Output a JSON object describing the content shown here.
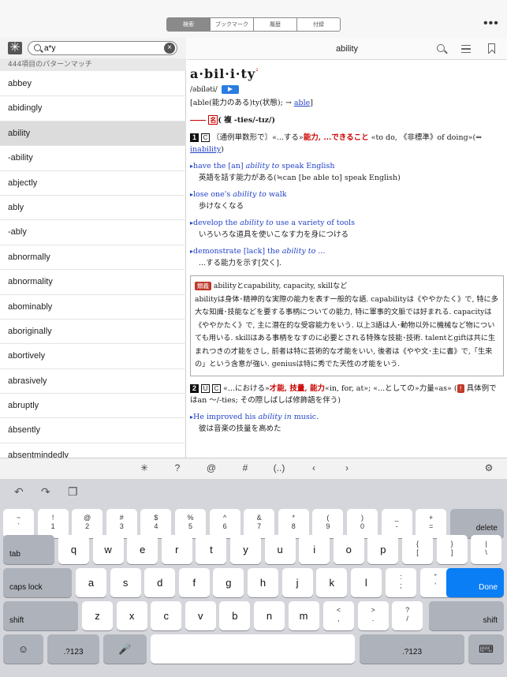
{
  "top_tabs": [
    "検索",
    "ブックマーク",
    "履歴",
    "付録"
  ],
  "active_tab": "検索",
  "more_label": "•••",
  "search": {
    "value": "a*y",
    "clear": "×",
    "wildcard_button": "✳︎"
  },
  "match_count": "444項目のパターンマッチ",
  "results": [
    "abbey",
    "abidingly",
    "ability",
    "-ability",
    "abjectly",
    "ably",
    "-ably",
    "abnormally",
    "abnormality",
    "abominably",
    "aboriginally",
    "abortively",
    "abrasively",
    "abruptly",
    "ábsently",
    "absentmindedly"
  ],
  "selected_result": "ability",
  "entry": {
    "title": "ability",
    "headword": "a·bil·i·ty",
    "headword_sup": "²",
    "pronunciation": "/əbíləti/",
    "etymology_pre": "[able(能力のある)ty(状態); → ",
    "etymology_link": "able",
    "etymology_post": "]",
    "pos_badge": "名",
    "pos_text": "( 複 -ties/-tɪz/)",
    "sense1": {
      "num": "1",
      "mark": "C",
      "text_a": "〘通例単数形で〙«...する»",
      "red": "能力, ...できること",
      "text_b": "«to do, 《非標準》of doing»(⇔",
      "link": "inability",
      "text_c": ")"
    },
    "examples1": [
      {
        "en_a": "have the [an] ",
        "en_i": "ability to",
        "en_b": " speak English",
        "ja": "英語を話す能力がある(≒can [be able to] speak English)"
      },
      {
        "en_a": "lose one's ",
        "en_i": "ability to",
        "en_b": " walk",
        "ja": "歩けなくなる"
      },
      {
        "en_a": "develop the ",
        "en_i": "ability to",
        "en_b": " use a variety of tools",
        "ja": "いろいろな道具を使いこなす力を身につける"
      },
      {
        "en_a": "demonstrate [lack] the ",
        "en_i": "ability to ...",
        "en_b": "",
        "ja": "...する能力を示す[欠く]."
      }
    ],
    "rui": {
      "tag": "類義",
      "head": "abilityとcapability, capacity, skillなど",
      "body": "abilityは身体･精神的な実際の能力を表す一般的な語. capabilityは《ややかたく》で, 特に多大な知識･技能などを要する事柄についての能力, 特に軍事的文脈では好まれる. capacityは《ややかたく》で, 主に潜在的な受容能力をいう. 以上3語は人･動物以外に機械など物についても用いる. skillはある事柄をなすのに必要とされる特殊な技能･技術. talentとgiftは共に生まれつきの才能をさし, 前者は特に芸術的な才能をいい, 後者は《やや文･主に書》で,「生来の」という含意が強い. geniusは特に秀でた天性の才能をいう."
    },
    "sense2": {
      "num": "2",
      "marks": [
        "U",
        "C"
      ],
      "text_a": "«...における»",
      "red": "才能, 技量, 能力",
      "text_b": "«in, for, at»; «...としての»力量«as» (",
      "badge": "!",
      "text_c": " 具体例ではan ～/-ties; その際しばしば修飾語を伴う)"
    },
    "examples2": [
      {
        "en_a": "He improved his ",
        "en_i": "ability in",
        "en_b": " music.",
        "ja": "彼は音楽の技量を高めた"
      }
    ]
  },
  "accessory_keys": [
    "✳︎",
    "?",
    "@",
    "#",
    "(..)",
    "‹",
    "›"
  ],
  "keyboard": {
    "row1": [
      [
        "~",
        "`"
      ],
      [
        "!",
        "1"
      ],
      [
        "@",
        "2"
      ],
      [
        "#",
        "3"
      ],
      [
        "$",
        "4"
      ],
      [
        "%",
        "5"
      ],
      [
        "^",
        "6"
      ],
      [
        "&",
        "7"
      ],
      [
        "*",
        "8"
      ],
      [
        "(",
        "9"
      ],
      [
        ")",
        "0"
      ],
      [
        "_",
        "-"
      ],
      [
        "+",
        "="
      ]
    ],
    "delete": "delete",
    "tab": "tab",
    "row2": [
      "q",
      "w",
      "e",
      "r",
      "t",
      "y",
      "u",
      "i",
      "o",
      "p"
    ],
    "row2_sym": [
      [
        "{",
        "["
      ],
      [
        "}",
        "]"
      ],
      [
        "|",
        "\\"
      ]
    ],
    "caps": "caps lock",
    "row3": [
      "a",
      "s",
      "d",
      "f",
      "g",
      "h",
      "j",
      "k",
      "l"
    ],
    "row3_sym": [
      [
        ":",
        ";"
      ],
      [
        "\"",
        "'"
      ]
    ],
    "done": "Done",
    "shift": "shift",
    "row4": [
      "z",
      "x",
      "c",
      "v",
      "b",
      "n",
      "m"
    ],
    "row4_sym": [
      [
        "<",
        ","
      ],
      [
        ">",
        "."
      ],
      [
        "?",
        "/"
      ]
    ],
    "num_switch": ".?123",
    "emoji_icon": "☺",
    "mic_icon": "🎤",
    "keyboard_icon": "⌨"
  }
}
